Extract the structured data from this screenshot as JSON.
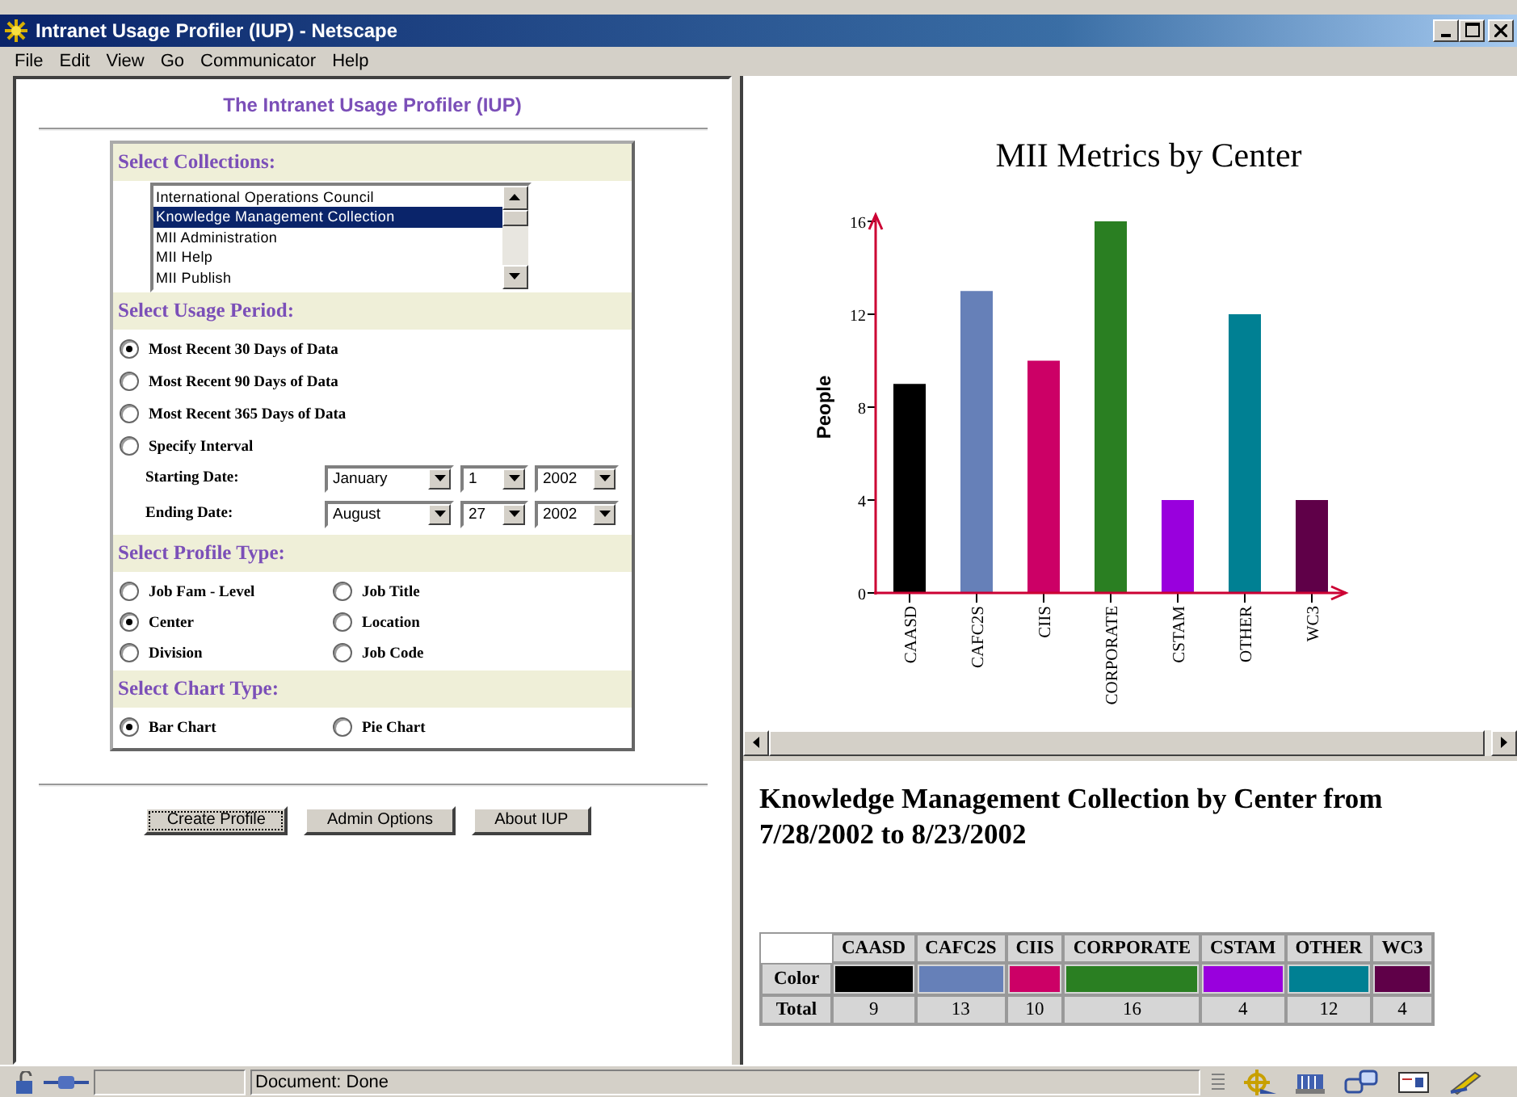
{
  "window": {
    "title": "Intranet Usage Profiler (IUP) - Netscape"
  },
  "menu": [
    "File",
    "Edit",
    "View",
    "Go",
    "Communicator",
    "Help"
  ],
  "form": {
    "title": "The Intranet Usage Profiler (IUP)",
    "collections": {
      "heading": "Select Collections:",
      "items": [
        {
          "label": "International Operations Council",
          "selected": false
        },
        {
          "label": "Knowledge Management Collection",
          "selected": true
        },
        {
          "label": "MII Administration",
          "selected": false
        },
        {
          "label": "MII Help",
          "selected": false
        },
        {
          "label": "MII Publish",
          "selected": false
        }
      ]
    },
    "period": {
      "heading": "Select Usage Period:",
      "options": [
        {
          "label": "Most Recent 30 Days of Data",
          "selected": true
        },
        {
          "label": "Most Recent 90 Days of Data",
          "selected": false
        },
        {
          "label": "Most Recent 365 Days of Data",
          "selected": false
        },
        {
          "label": "Specify Interval",
          "selected": false
        }
      ],
      "dates": [
        {
          "label": "Starting Date:",
          "month": "January",
          "day": "1",
          "year": "2002"
        },
        {
          "label": "Ending Date:",
          "month": "August",
          "day": "27",
          "year": "2002"
        }
      ]
    },
    "profile": {
      "heading": "Select Profile Type:",
      "options": [
        {
          "label": "Job Fam - Level",
          "selected": false
        },
        {
          "label": "Job Title",
          "selected": false
        },
        {
          "label": "Center",
          "selected": true
        },
        {
          "label": "Location",
          "selected": false
        },
        {
          "label": "Division",
          "selected": false
        },
        {
          "label": "Job Code",
          "selected": false
        }
      ]
    },
    "chart_type": {
      "heading": "Select Chart Type:",
      "options": [
        {
          "label": "Bar Chart",
          "selected": true
        },
        {
          "label": "Pie Chart",
          "selected": false
        }
      ]
    },
    "buttons": [
      {
        "label": "Create Profile",
        "focused": true
      },
      {
        "label": "Admin Options",
        "focused": false
      },
      {
        "label": "About IUP",
        "focused": false
      }
    ]
  },
  "chart_data": {
    "type": "bar",
    "title": "MII Metrics by Center",
    "ylabel": "People",
    "categories": [
      "CAASD",
      "CAFC2S",
      "CIIS",
      "CORPORATE",
      "CSTAM",
      "OTHER",
      "WC3"
    ],
    "series": [
      {
        "values": [
          9,
          13,
          10,
          16,
          4,
          12,
          4
        ]
      }
    ],
    "ylim": [
      0,
      16
    ],
    "yticks": [
      0,
      4,
      8,
      12,
      16
    ]
  },
  "report": {
    "title": "Knowledge Management Collection by Center from 7/28/2002 to 8/23/2002",
    "row_labels": [
      "Color",
      "Total"
    ],
    "entries": [
      {
        "name": "CAASD",
        "color": "#000000",
        "total": "9"
      },
      {
        "name": "CAFC2S",
        "color": "#6680b8",
        "total": "13"
      },
      {
        "name": "CIIS",
        "color": "#cc0066",
        "total": "10"
      },
      {
        "name": "CORPORATE",
        "color": "#2a7f22",
        "total": "16"
      },
      {
        "name": "CSTAM",
        "color": "#9900dd",
        "total": "4"
      },
      {
        "name": "OTHER",
        "color": "#008093",
        "total": "12"
      },
      {
        "name": "WC3",
        "color": "#5f0048",
        "total": "4"
      }
    ]
  },
  "status_bar": {
    "text": "Document: Done"
  }
}
